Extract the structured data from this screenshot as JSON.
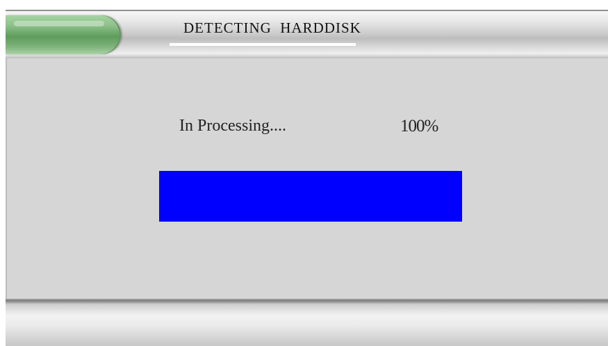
{
  "dialog": {
    "title": "DETECTING  HARDDISK",
    "status_label": "In Processing....",
    "progress_text": "100%",
    "progress_fraction": 1.0,
    "colors": {
      "progress_fill": "#0000ff",
      "panel_background": "#d6d6d6",
      "title_tab": "#6fa96c"
    }
  }
}
